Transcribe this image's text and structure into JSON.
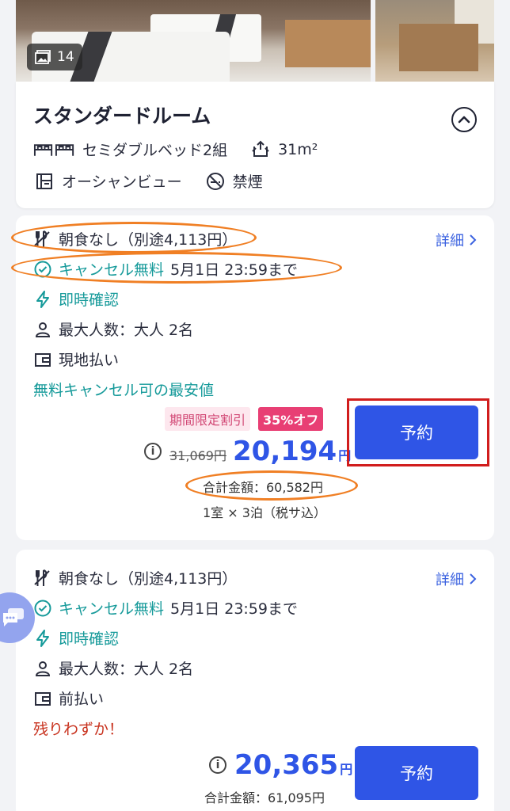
{
  "photos": {
    "count": "14"
  },
  "room": {
    "title": "スタンダードルーム",
    "bed": "セミダブルベッド2組",
    "size": "31m²",
    "view": "オーシャンビュー",
    "smoking": "禁煙"
  },
  "offers": [
    {
      "meal": "朝食なし（別途4,113円）",
      "details_label": "詳細",
      "cancel_label": "キャンセル無料",
      "cancel_deadline": "5月1日 23:59まで",
      "confirmation": "即時確認",
      "occupancy": "最大人数：大人 2名",
      "payment": "現地払い",
      "note": "無料キャンセル可の最安値",
      "promo_tag": "期間限定割引",
      "promo_discount": "35%オフ",
      "original_price": "31,069円",
      "price": "20,194",
      "currency": "円",
      "total": "合計金額：60,582円",
      "stay": "1室 × 3泊（税サ込）",
      "book_label": "予約"
    },
    {
      "meal": "朝食なし（別途4,113円）",
      "details_label": "詳細",
      "cancel_label": "キャンセル無料",
      "cancel_deadline": "5月1日 23:59まで",
      "confirmation": "即時確認",
      "occupancy": "最大人数：大人 2名",
      "payment": "前払い",
      "note": "残りわずか！",
      "price": "20,365",
      "currency": "円",
      "total": "合計金額：61,095円",
      "book_label": "予約"
    }
  ],
  "colors": {
    "accent_blue": "#2f55e6",
    "teal": "#169a9a",
    "promo_pink": "#e83f74",
    "annotation_orange": "#f07f24",
    "annotation_red": "#d11d1d"
  }
}
